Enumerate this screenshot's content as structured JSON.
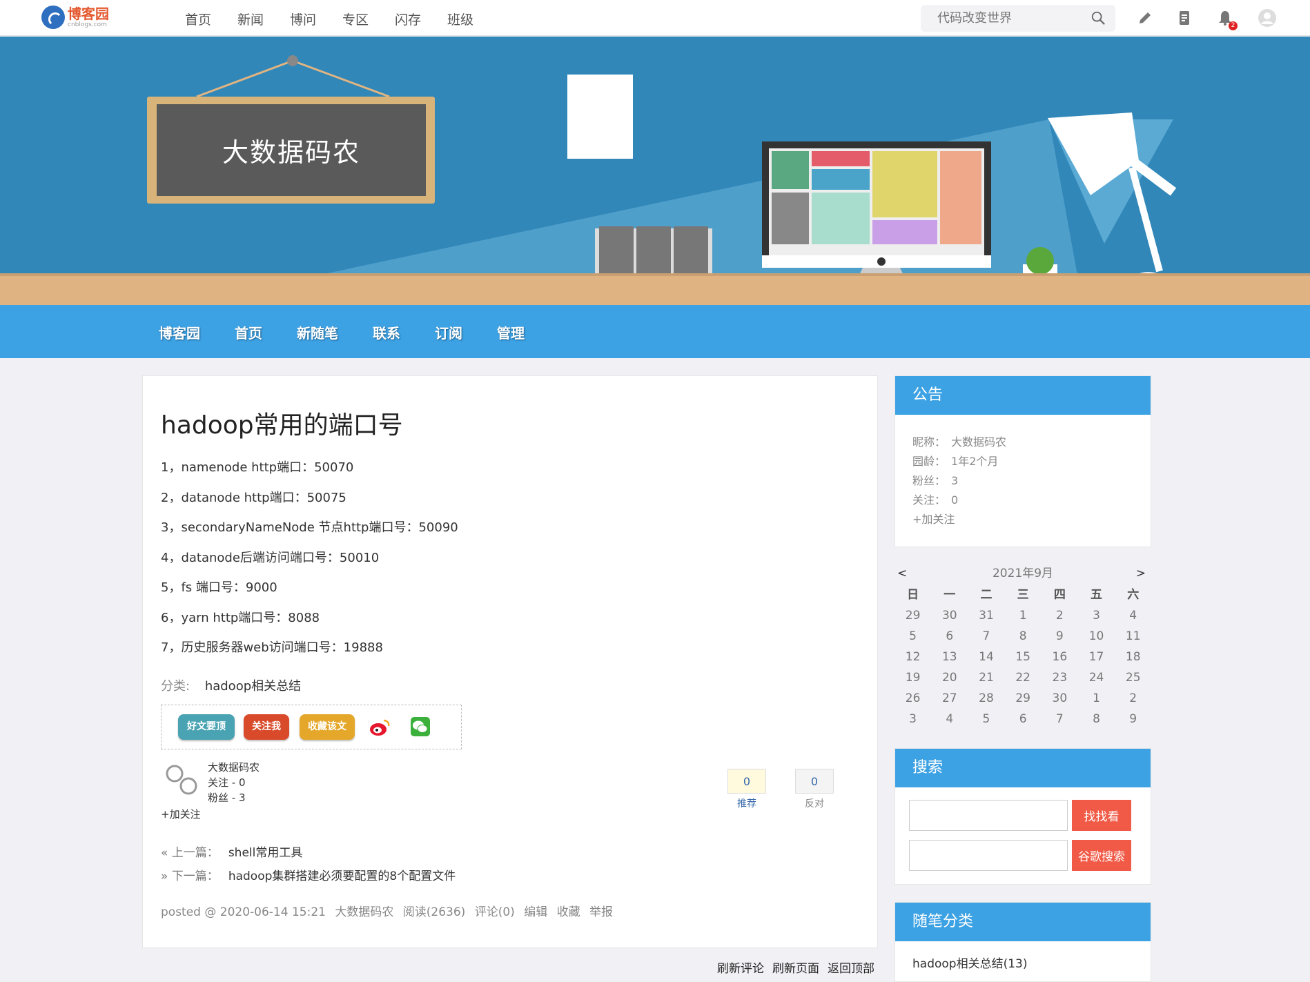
{
  "topbar": {
    "logo_cn": "博客园",
    "logo_en": "cnblogs.com",
    "nav": [
      "首页",
      "新闻",
      "博问",
      "专区",
      "闪存",
      "班级"
    ],
    "search_placeholder": "代码改变世界",
    "notification_count": "2"
  },
  "banner": {
    "title": "大数据码农"
  },
  "blognav": [
    "博客园",
    "首页",
    "新随笔",
    "联系",
    "订阅",
    "管理"
  ],
  "post": {
    "title": "hadoop常用的端口号",
    "lines": [
      "1，namenode http端口：50070",
      "2，datanode http端口：50075",
      "3，secondaryNameNode 节点http端口号：50090",
      "4，datanode后端访问端口号：50010",
      "5，fs 端口号：9000",
      "6，yarn http端口号：8088",
      "7，历史服务器web访问端口号：19888"
    ],
    "category_label": "分类:",
    "category": "hadoop相关总结",
    "buttons": {
      "good": "好文要顶",
      "follow": "关注我",
      "fav": "收藏该文"
    },
    "author": {
      "name": "大数据码农",
      "follow": "关注 - 0",
      "fans": "粉丝 - 3",
      "add_follow": "+加关注"
    },
    "vote": {
      "dig_count": "0",
      "dig_label": "推荐",
      "bury_count": "0",
      "bury_label": "反对"
    },
    "prev_label": "« 上一篇：",
    "prev": "shell常用工具",
    "next_label": "» 下一篇：",
    "next": "hadoop集群搭建必须要配置的8个配置文件",
    "info": {
      "posted": "posted @ 2020-06-14 15:21",
      "author": "大数据码农",
      "reads": "阅读(2636)",
      "comments": "评论(0)",
      "edit": "编辑",
      "fav": "收藏",
      "report": "举报"
    }
  },
  "footer_links": [
    "刷新评论",
    "刷新页面",
    "返回顶部"
  ],
  "sidebar": {
    "notice": {
      "title": "公告",
      "nick_k": "昵称：",
      "nick_v": "大数据码农",
      "age_k": "园龄：",
      "age_v": "1年2个月",
      "fans_k": "粉丝：",
      "fans_v": "3",
      "follow_k": "关注：",
      "follow_v": "0",
      "add_follow": "+加关注"
    },
    "calendar": {
      "title": "2021年9月",
      "prev": "<",
      "next": ">",
      "weekdays": [
        "日",
        "一",
        "二",
        "三",
        "四",
        "五",
        "六"
      ],
      "days": [
        "29",
        "30",
        "31",
        "1",
        "2",
        "3",
        "4",
        "5",
        "6",
        "7",
        "8",
        "9",
        "10",
        "11",
        "12",
        "13",
        "14",
        "15",
        "16",
        "17",
        "18",
        "19",
        "20",
        "21",
        "22",
        "23",
        "24",
        "25",
        "26",
        "27",
        "28",
        "29",
        "30",
        "1",
        "2",
        "3",
        "4",
        "5",
        "6",
        "7",
        "8",
        "9"
      ]
    },
    "search": {
      "title": "搜索",
      "btn1": "找找看",
      "btn2": "谷歌搜索"
    },
    "categories": {
      "title": "随笔分类",
      "items": [
        "hadoop相关总结(13)"
      ]
    }
  }
}
